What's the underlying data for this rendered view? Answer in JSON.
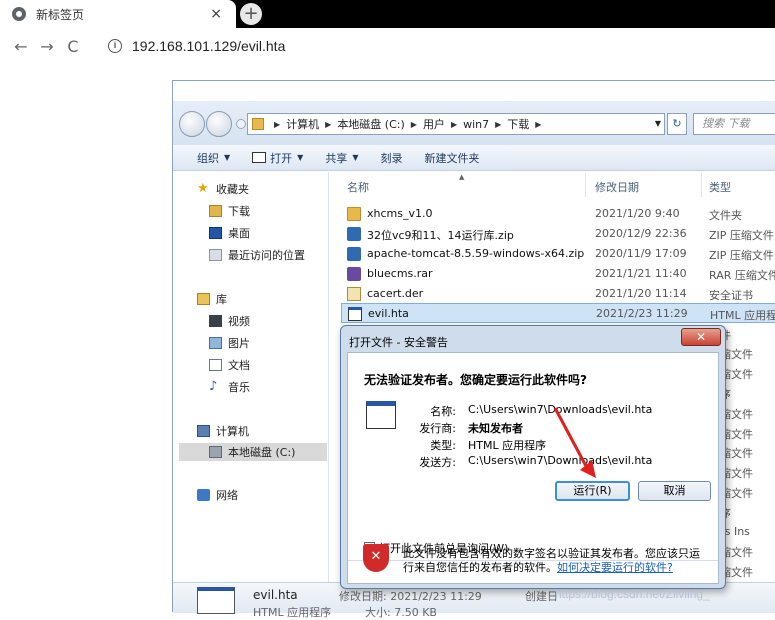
{
  "browser": {
    "tab_title": "新标签页",
    "tab_close": "×",
    "new_tab": "+",
    "back": "←",
    "forward": "→",
    "reload": "C",
    "url": "192.168.101.129/evil.hta"
  },
  "explorer": {
    "breadcrumb": [
      "计算机",
      "本地磁盘 (C:)",
      "用户",
      "win7",
      "下载"
    ],
    "search_placeholder": "搜索 下载",
    "commands": {
      "organize": "组织",
      "open": "打开",
      "share": "共享",
      "burn": "刻录",
      "new_folder": "新建文件夹"
    },
    "nav": {
      "favorites": "收藏夹",
      "downloads": "下载",
      "desktop": "桌面",
      "recent": "最近访问的位置",
      "libraries": "库",
      "videos": "视频",
      "pictures": "图片",
      "documents": "文档",
      "music": "音乐",
      "computer": "计算机",
      "local_disk": "本地磁盘 (C:)",
      "network": "网络"
    },
    "columns": {
      "name": "名称",
      "date": "修改日期",
      "type": "类型"
    },
    "files": [
      {
        "name": "xhcms_v1.0",
        "date": "2021/1/20 9:40",
        "type": "文件夹",
        "icon": "folder-icon"
      },
      {
        "name": "32位vc9和11、14运行库.zip",
        "date": "2020/12/9 22:36",
        "type": "ZIP 压缩文件",
        "icon": "zip-icon"
      },
      {
        "name": "apache-tomcat-8.5.59-windows-x64.zip",
        "date": "2020/11/9 17:09",
        "type": "ZIP 压缩文件",
        "icon": "zip-icon"
      },
      {
        "name": "bluecms.rar",
        "date": "2021/1/21 11:40",
        "type": "RAR 压缩文件",
        "icon": "rar-icon"
      },
      {
        "name": "cacert.der",
        "date": "2021/1/20 11:14",
        "type": "安全证书",
        "icon": "certificate-icon"
      },
      {
        "name": "evil.hta",
        "date": "2021/2/23 11:29",
        "type": "HTML 应用程",
        "icon": "hta-icon"
      }
    ],
    "hidden_types": [
      "文件",
      "压缩文件",
      "压缩文件",
      "程序",
      "压缩文件",
      "压缩文件",
      "压缩文件",
      "压缩文件",
      "压缩文件",
      "程序",
      "ows Ins",
      "压缩文件",
      "压缩文件",
      "压缩文件"
    ],
    "details": {
      "name": "evil.hta",
      "modified": "修改日期: 2021/2/23 11:29",
      "created": "创建日",
      "type": "HTML 应用程序",
      "size": "大小: 7.50 KB"
    }
  },
  "dialog": {
    "title": "打开文件 - 安全警告",
    "close": "✕",
    "question": "无法验证发布者。您确定要运行此软件吗?",
    "labels": {
      "name": "名称:",
      "publisher": "发行商:",
      "type": "类型:",
      "from": "发送方:"
    },
    "values": {
      "name": "C:\\Users\\win7\\Downloads\\evil.hta",
      "publisher": "未知发布者",
      "type": "HTML 应用程序",
      "from": "C:\\Users\\win7\\Downloads\\evil.hta"
    },
    "run_button": "运行(R)",
    "cancel_button": "取消",
    "always_ask": "打开此文件前总是询问(W)",
    "warning_text": "此文件没有包含有效的数字签名以验证其发布者。您应该只运行来自您信任的发布者的软件。",
    "warning_link": "如何决定要运行的软件?"
  },
  "watermark": "https://blog.csdn.net/Zllviing_"
}
